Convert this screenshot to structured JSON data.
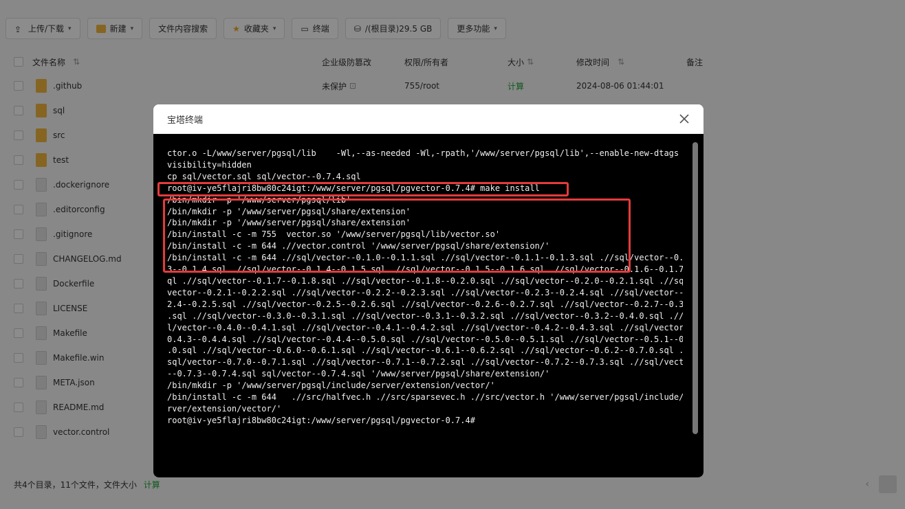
{
  "toolbar": {
    "upload": "上传/下载",
    "new": "新建",
    "search_content": "文件内容搜索",
    "favorites": "收藏夹",
    "terminal": "终端",
    "disk": "/(根目录)29.5 GB",
    "more": "更多功能"
  },
  "table": {
    "headers": {
      "name": "文件名称",
      "protect": "企业级防篡改",
      "perm": "权限/所有者",
      "size": "大小",
      "mtime": "修改时间",
      "note": "备注"
    },
    "first_row": {
      "name": ".github",
      "protect": "未保护",
      "perm": "755/root",
      "size": "计算",
      "mtime": "2024-08-06 01:44:01"
    },
    "rows": [
      {
        "name": "sql",
        "type": "dir"
      },
      {
        "name": "src",
        "type": "dir"
      },
      {
        "name": "test",
        "type": "dir"
      },
      {
        "name": ".dockerignore",
        "type": "file"
      },
      {
        "name": ".editorconfig",
        "type": "file"
      },
      {
        "name": ".gitignore",
        "type": "file"
      },
      {
        "name": "CHANGELOG.md",
        "type": "file"
      },
      {
        "name": "Dockerfile",
        "type": "file"
      },
      {
        "name": "LICENSE",
        "type": "file"
      },
      {
        "name": "Makefile",
        "type": "file"
      },
      {
        "name": "Makefile.win",
        "type": "file"
      },
      {
        "name": "META.json",
        "type": "file"
      },
      {
        "name": "README.md",
        "type": "file"
      },
      {
        "name": "vector.control",
        "type": "file"
      }
    ]
  },
  "footer": {
    "summary": "共4个目录，11个文件，文件大小",
    "calc": "计算"
  },
  "modal": {
    "title": "宝塔终端",
    "lines": [
      "ctor.o -L/www/server/pgsql/lib    -Wl,--as-needed -Wl,-rpath,'/www/server/pgsql/lib',--enable-new-dtags -f",
      "visibility=hidden",
      "cp sql/vector.sql sql/vector--0.7.4.sql",
      "root@iv-ye5flajri8bw80c24igt:/www/server/pgsql/pgvector-0.7.4# make install",
      "/bin/mkdir -p '/www/server/pgsql/lib'",
      "/bin/mkdir -p '/www/server/pgsql/share/extension'",
      "/bin/mkdir -p '/www/server/pgsql/share/extension'",
      "/bin/install -c -m 755  vector.so '/www/server/pgsql/lib/vector.so'",
      "/bin/install -c -m 644 .//vector.control '/www/server/pgsql/share/extension/'",
      "/bin/install -c -m 644 .//sql/vector--0.1.0--0.1.1.sql .//sql/vector--0.1.1--0.1.3.sql .//sql/vector--0.1.",
      "3--0.1.4.sql .//sql/vector--0.1.4--0.1.5.sql .//sql/vector--0.1.5--0.1.6.sql .//sql/vector--0.1.6--0.1.7.s",
      "ql .//sql/vector--0.1.7--0.1.8.sql .//sql/vector--0.1.8--0.2.0.sql .//sql/vector--0.2.0--0.2.1.sql .//sql/",
      "vector--0.2.1--0.2.2.sql .//sql/vector--0.2.2--0.2.3.sql .//sql/vector--0.2.3--0.2.4.sql .//sql/vector--0.",
      "2.4--0.2.5.sql .//sql/vector--0.2.5--0.2.6.sql .//sql/vector--0.2.6--0.2.7.sql .//sql/vector--0.2.7--0.3.0",
      ".sql .//sql/vector--0.3.0--0.3.1.sql .//sql/vector--0.3.1--0.3.2.sql .//sql/vector--0.3.2--0.4.0.sql .//sq",
      "l/vector--0.4.0--0.4.1.sql .//sql/vector--0.4.1--0.4.2.sql .//sql/vector--0.4.2--0.4.3.sql .//sql/vector--",
      "0.4.3--0.4.4.sql .//sql/vector--0.4.4--0.5.0.sql .//sql/vector--0.5.0--0.5.1.sql .//sql/vector--0.5.1--0.6",
      ".0.sql .//sql/vector--0.6.0--0.6.1.sql .//sql/vector--0.6.1--0.6.2.sql .//sql/vector--0.6.2--0.7.0.sql .//",
      "sql/vector--0.7.0--0.7.1.sql .//sql/vector--0.7.1--0.7.2.sql .//sql/vector--0.7.2--0.7.3.sql .//sql/vector",
      "--0.7.3--0.7.4.sql sql/vector--0.7.4.sql '/www/server/pgsql/share/extension/'",
      "/bin/mkdir -p '/www/server/pgsql/include/server/extension/vector/'",
      "/bin/install -c -m 644   .//src/halfvec.h .//src/sparsevec.h .//src/vector.h '/www/server/pgsql/include/se",
      "rver/extension/vector/'",
      "root@iv-ye5flajri8bw80c24igt:/www/server/pgsql/pgvector-0.7.4#"
    ]
  },
  "colors": {
    "accent_green": "#20a53a",
    "highlight_red": "#e53b3b",
    "terminal_bg": "#000000"
  }
}
